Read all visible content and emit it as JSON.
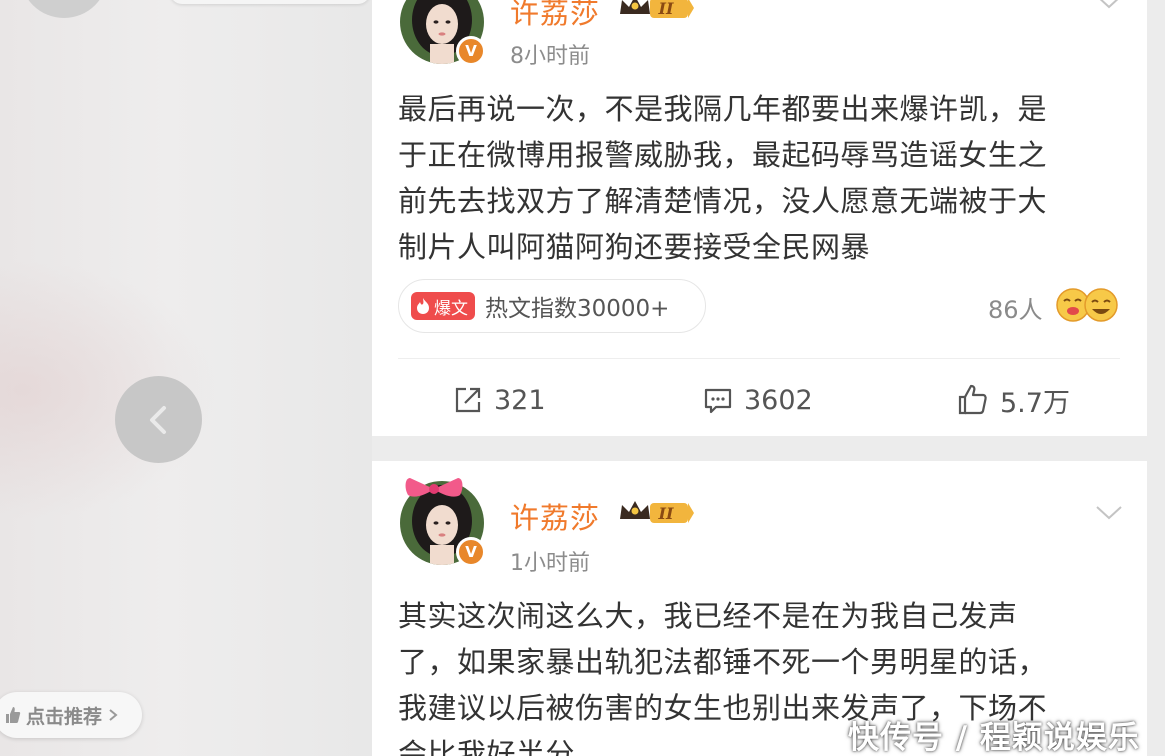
{
  "colors": {
    "username": "#f07a2c",
    "verified_badge": "#e8872a",
    "hot_tag": "#ef4c4c",
    "crown": "#e7a23a"
  },
  "left_panel": {
    "prev_icon": "chevron-left-icon",
    "recommend_label": "点击推荐"
  },
  "posts": [
    {
      "username": "许荔莎",
      "badge_level": "II",
      "time": "8小时前",
      "text": "最后再说一次，不是我隔几年都要出来爆许凯，是\n于正在微博用报警威胁我，最起码辱骂造谣女生之\n前先去找双方了解清楚情况，没人愿意无端被于大\n制片人叫阿猫阿狗还要接受全民网暴",
      "hot_tag": "爆文",
      "hot_text": "热文指数30000+",
      "reactions": "86人",
      "share_count": "321",
      "comment_count": "3602",
      "like_count": "5.7万"
    },
    {
      "username": "许荔莎",
      "badge_level": "II",
      "time": "1小时前",
      "text": "其实这次闹这么大，我已经不是在为我自己发声\n了，如果家暴出轨犯法都锤不死一个男明星的话，\n我建议以后被伤害的女生也别出来发声了，下场不\n会比我好半分"
    }
  ],
  "watermark": "快传号 / 程颖说娱乐"
}
